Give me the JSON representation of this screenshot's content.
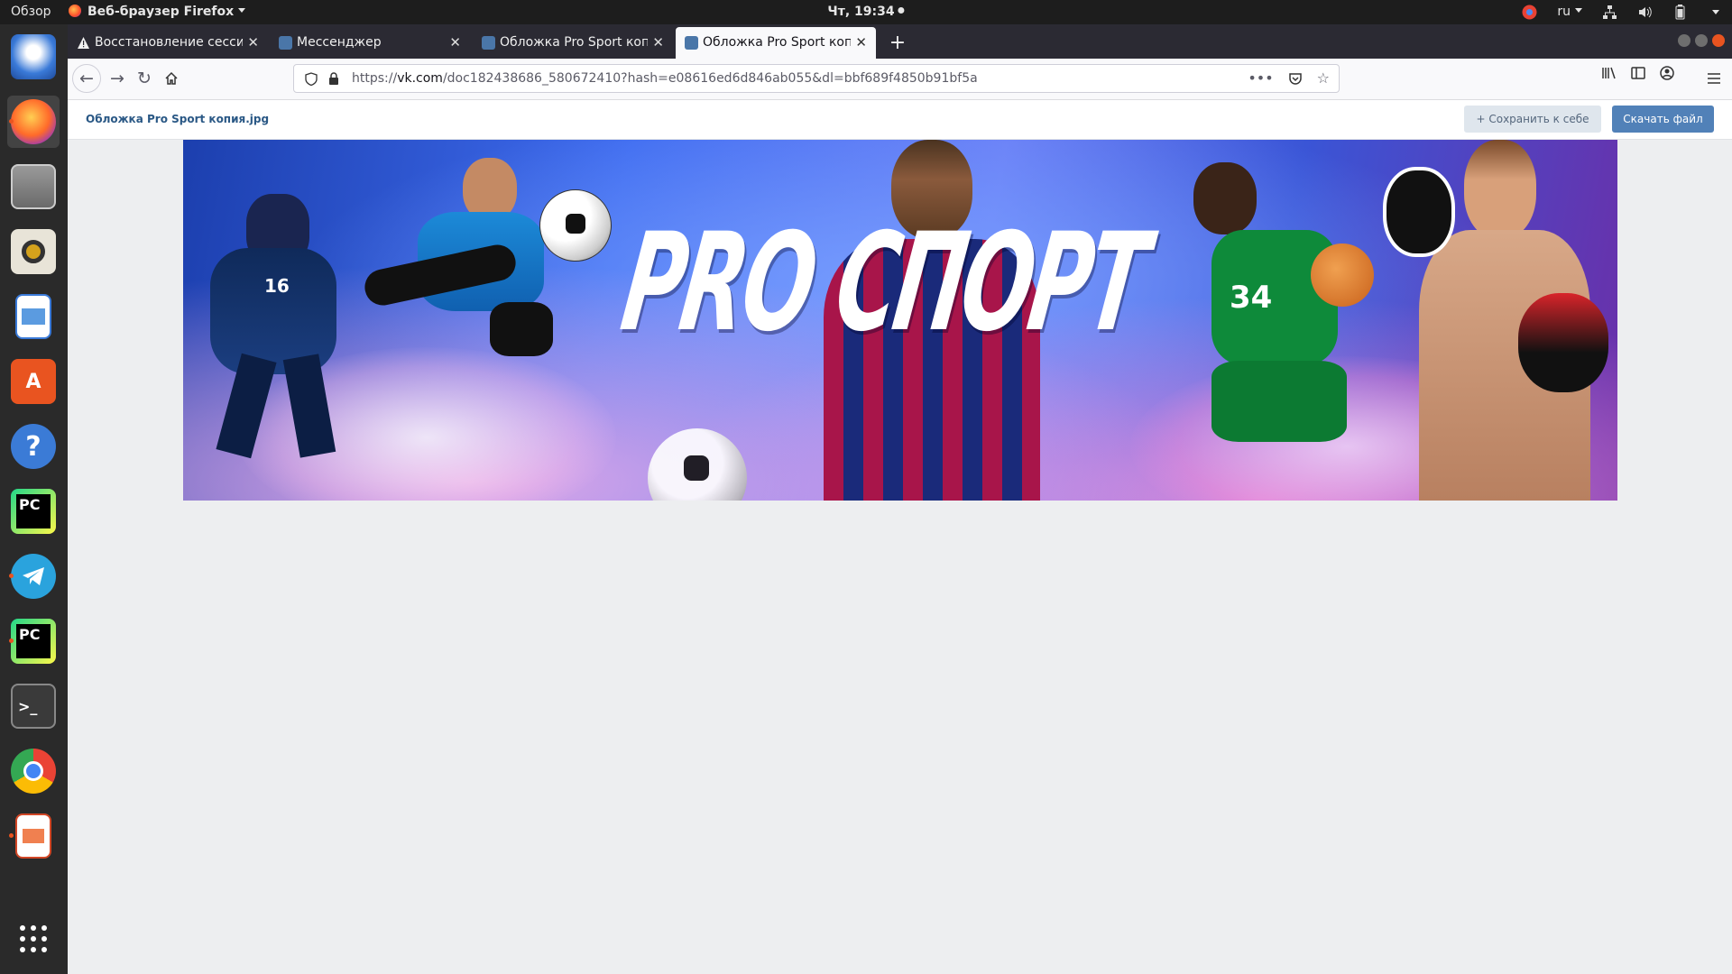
{
  "topbar": {
    "activities": "Обзор",
    "app_name": "Веб-браузер Firefox",
    "clock": "Чт, 19:34",
    "lang": "ru"
  },
  "dock": {
    "apps": [
      "thunderbird-icon",
      "firefox-icon",
      "files-icon",
      "rhythmbox-icon",
      "libreoffice-writer-icon",
      "software-center-icon",
      "help-icon",
      "pycharm-icon",
      "telegram-icon",
      "pycharm-ce-icon",
      "terminal-icon",
      "chrome-icon",
      "libreoffice-impress-icon",
      "show-apps-icon"
    ]
  },
  "browser": {
    "tabs": [
      {
        "title": "Восстановление сессии",
        "icon": "warning-icon"
      },
      {
        "title": "Мессенджер",
        "icon": "vk-messenger-icon"
      },
      {
        "title": "Обложка Pro Sport копия.jpg",
        "icon": "vk-icon"
      },
      {
        "title": "Обложка Pro Sport копия.jpg",
        "icon": "vk-icon"
      }
    ],
    "url_prefix": "https://",
    "url_host": "vk.com",
    "url_path": "/doc182438686_580672410?hash=e08616ed6d846ab055&dl=bbf689f4850b91bf5a"
  },
  "page": {
    "doc_title": "Обложка Pro Sport копия.jpg",
    "save_label": "Сохранить к себе",
    "download_label": "Скачать файл",
    "banner_text": "PRO СПОРТ"
  },
  "colors": {
    "vk_link": "#2a5885",
    "vk_button": "#5181b8",
    "ubuntu_orange": "#e95420"
  }
}
